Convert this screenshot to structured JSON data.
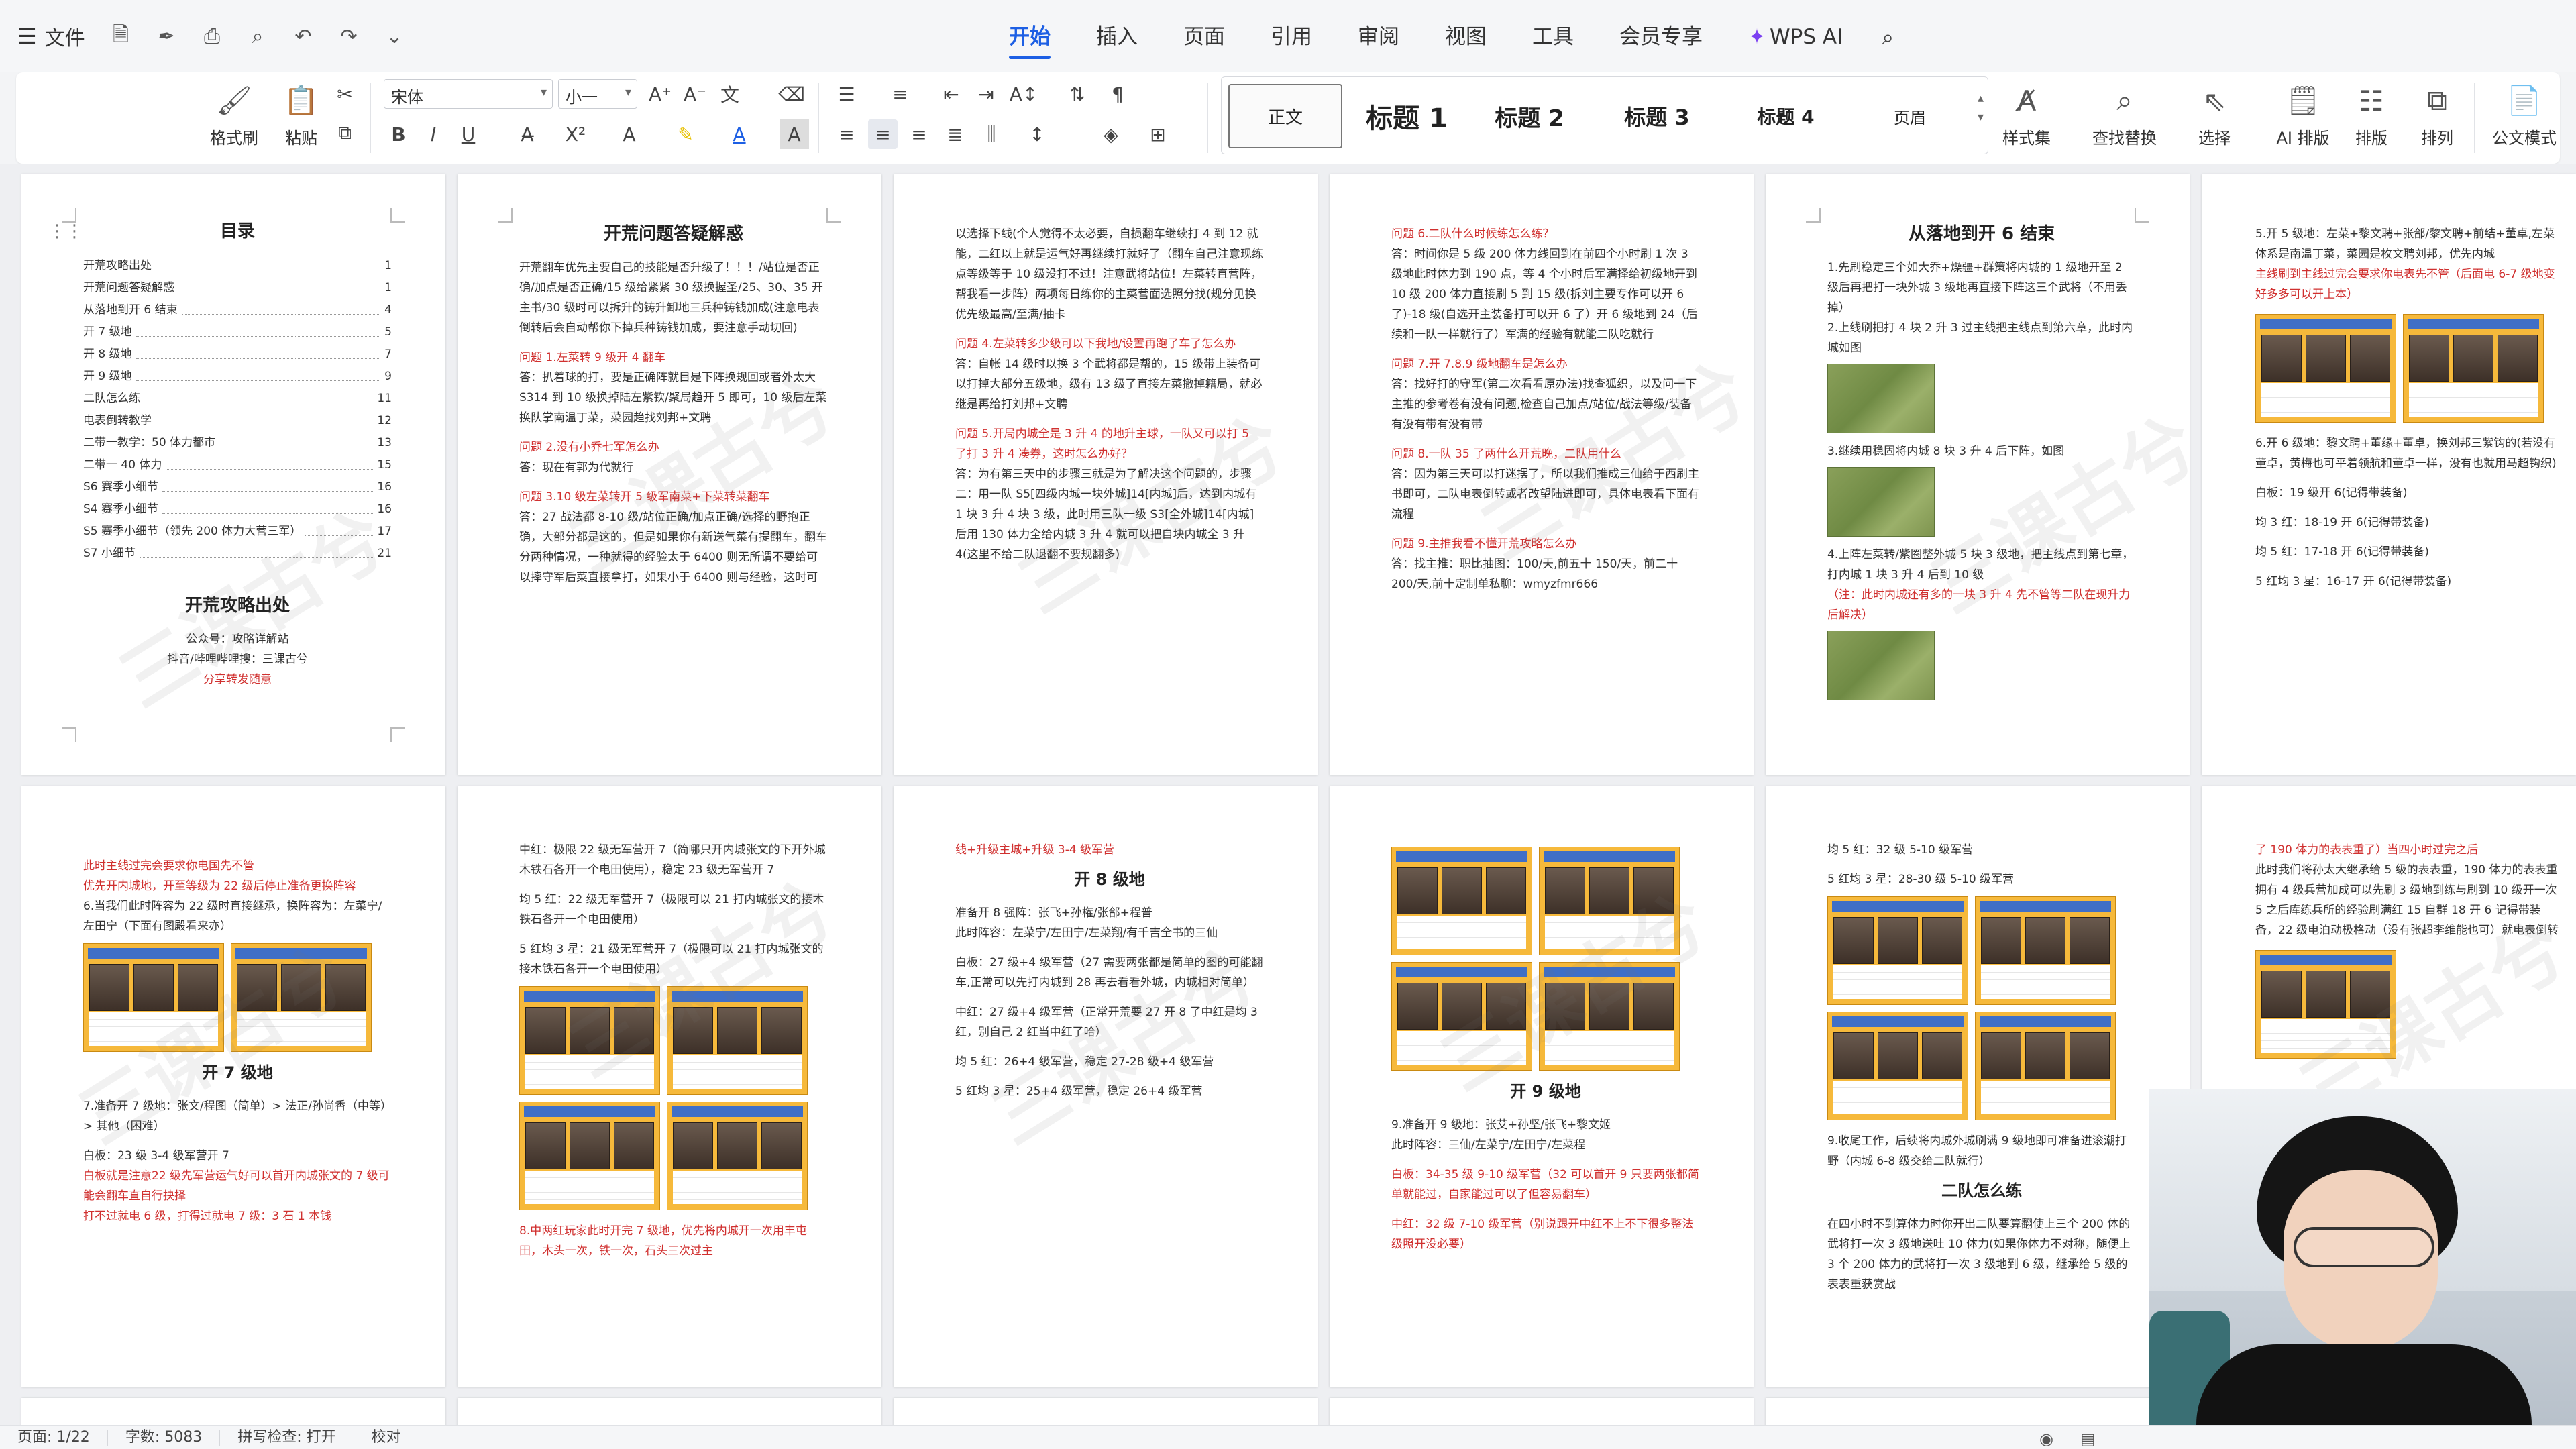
{
  "menubar": {
    "file": "文件",
    "tabs": [
      "开始",
      "插入",
      "页面",
      "引用",
      "审阅",
      "视图",
      "工具",
      "会员专享",
      "WPS AI"
    ],
    "active_tab": "开始"
  },
  "ribbon": {
    "format_painter": "格式刷",
    "paste": "粘贴",
    "font_name": "宋体",
    "font_size": "小一",
    "styles": [
      "正文",
      "标题 1",
      "标题 2",
      "标题 3",
      "标题 4",
      "页眉"
    ],
    "style_set": "样式集",
    "find_replace": "查找替换",
    "select": "选择",
    "ai_layout": "AI 排版",
    "layout": "排版",
    "arrange": "排列",
    "doc_mode": "公文模式"
  },
  "pages": {
    "p1": {
      "toc_title": "目录",
      "toc": [
        {
          "t": "开荒攻略出处",
          "n": "1"
        },
        {
          "t": "开荒问题答疑解惑",
          "n": "1"
        },
        {
          "t": "从落地到开 6 结束",
          "n": "4"
        },
        {
          "t": "开 7 级地",
          "n": "5"
        },
        {
          "t": "开 8 级地",
          "n": "7"
        },
        {
          "t": "开 9 级地",
          "n": "9"
        },
        {
          "t": "二队怎么练",
          "n": "11"
        },
        {
          "t": "电表倒转教学",
          "n": "12"
        },
        {
          "t": "二带一教学：50 体力都市",
          "n": "13"
        },
        {
          "t": "二带一 40 体力",
          "n": "15"
        },
        {
          "t": "S6 赛季小细节",
          "n": "16"
        },
        {
          "t": "S4 赛季小细节",
          "n": "16"
        },
        {
          "t": "S5 赛季小细节（领先 200 体力大营三军）",
          "n": "17"
        },
        {
          "t": "S7 小细节",
          "n": "21"
        }
      ],
      "section_title": "开荒攻略出处",
      "line1": "公众号：攻略详解站",
      "line2": "抖音/哔哩哔哩搜：三课古兮",
      "line3": "分享转发随意"
    },
    "p2": {
      "title": "开荒问题答疑解惑",
      "intro": "开荒翻车优先主要自己的技能是否升级了！！！/站位是否正确/加点是否正确/15 级给紧紧 30 级换握圣/25、30、35 开主书/30 级时可以拆升的铸升卸地三兵种铸钱加成(注意电表倒转后会自动帮你下掉兵种铸钱加成，要注意手动切回)",
      "q1": "问题 1.左菜转 9 级开 4 翻车",
      "a1": "答：扒着球的打，要是正确阵就目是下阵换规回或者外太大 S314 到 10 级换掉陆左紫钦/聚局趋开 5 即可，10 级后左菜换队掌南温丁菜，菜园趋找刘邦+文聘",
      "q2": "问题 2.没有小乔七军怎么办",
      "a2": "答：現在有郭为代就行",
      "q3": "问题 3.10 级左菜转开 5 级军南菜+下菜转菜翻车",
      "a3": "答：27 战法都 8-10 级/站位正确/加点正确/选择的野抱正确，大部分都是这的，但是如果你有新送气菜有提翻车，翻车分两种情况，一种就得的经验太于 6400 则无所谓不要给可以摔守军后菜直接拿打，如果小于 6400 则与经验，这时可"
    },
    "p3": {
      "body1": "以选择下线(个人觉得不太必要，自损翻车继续打 4 到 12 就能，二红以上就是运气好再继续打就好了（翻车自己注意现练点等级等于 10 级没打不过！注意武将站位！左菜转直营阵，帮我看一步阵）两项每日练你的主菜营面选照分找(规分见换优先级最高/至满/抽卡",
      "q4": "问题 4.左菜转多少级可以下我地/设置再跑了车了怎么办",
      "a4": "答：自帐 14 级时以换 3 个武将都是帮的，15 级带上装备可以打掉大部分五级地，级有 13 级了直接左菜撤掉籍局，就必继是再给打刘邦+文聘",
      "q5": "问题 5.开局内城全是 3 升 4 的地升主球，一队又可以打 5 了打 3 升 4 凑券，这时怎么办好？",
      "a5": "答：为有第三天中的步骤三就是为了解决这个问题的，步骤二：用一队 S5[四级内城一块外城]14[内城]后，达到内城有 1 块 3 升 4 块 3 级，此时用三队一级 S3[全外城]14[内城]后用 130 体力全给内城 3 升 4 就可以把自块内城全 3 升 4(这里不给二队退翻不要规翻多)"
    },
    "p4": {
      "q6": "问题 6.二队什么时候练怎么练？",
      "a6": "答：时间你是 5 级 200 体力线回到在前四个小时刷 1 次 3 级地此时体力到 190 点，等 4 个小时后军满择给初级地开到 10 级 200 体力直接刷 5 到 15 级(拆刘主要专作可以开 6 了)-18 级(自选开主装备打可以开 6 了）开 6 级地到 24（后续和一队一样就行了）军满的经验有就能二队吃就行",
      "q7": "问题 7.开 7.8.9 级地翻车是怎么办",
      "a7": "答：找好打的守军(第二次看看原办法)找查狐织，以及问一下主推的参考卷有没有问题,检查自己加点/站位/战法等级/装备有没有带有没有带",
      "q8": "问题 8.一队 35 了两什么开荒晚，二队用什么",
      "a8": "答：因为第三天可以打迷摆了，所以我们推成三仙给于西刷主书即可，二队电表倒转或者改望陆进即可，具体电表看下面有流程",
      "q9": "问题 9.主推我看不懂开荒攻略怎么办",
      "a9": "答：找主推：职比抽图：100/天,前五十 150/天，前二十 200/天,前十定制单私聊：wmyzfmr666"
    },
    "p5": {
      "title": "从落地到开 6 结束",
      "s1": "1.先刷稳定三个如大乔+燥疆+群策将内城的 1 级地开至 2 级后再把打一块外城 3 级地再直接下阵这三个武将（不用丢掉）",
      "s2": "2.上线刷把打 4 块 2 升 3 过主线把主线点到第六章，此时内城如图",
      "s3": "3.继续用稳固将内城 8 块 3 升 4 后下阵，如图",
      "s4": "4.上阵左菜转/紫圈整外城 5 块 3 级地，把主线点到第七章，打内城 1 块 3 升 4 后到 10 级",
      "s4note": "（注：此时内城还有多的一块 3 升 4 先不管等二队在现升力后解决）"
    },
    "p6": {
      "s5": "5.开 5 级地：左菜+黎文聘+张郃/黎文聘+前结+董卓,左菜体系是南温丁菜，菜园是枚文聘刘邦，优先内城",
      "s5red": "主线刷到主线过完会要求你电表先不管（后面电 6-7 级地变好多多可以开上本）",
      "s6": "6.开 6 级地：黎文聘+董缘+董卓，换刘邦三紫钩的(若没有董卓，黄梅也可平着领航和董卓一样，没有也就用马超钩织)",
      "r1": "白板：19 级开 6(记得带装备)",
      "r2": "均 3 红：18-19 开 6(记得带装备)",
      "r3": "均 5 红：17-18 开 6(记得带装备)",
      "r4": "5 红均 3 星：16-17 开 6(记得带装备)"
    },
    "p7": {
      "l1": "此时主线过完会要求你电国先不管",
      "l2": "优先开内城地，开至等级为 22 级后停止准备更换阵容",
      "l3": "6.当我们此时阵容为 22 级时直接继承，换阵容为：左菜宁/左田宁（下面有图殿看来亦）",
      "title": "开 7 级地",
      "l4": "7.准备开 7 级地：张文/程图（简单）> 法正/孙尚香（中等）> 其他（困难）",
      "l5": "白板：23 级 3-4 级军营开 7",
      "l6": "白板就是注意22 级先军营运气好可以首开内城张文的 7 级可能会翻车直自行抉择",
      "l7": "打不过就电 6 级，打得过就电 7 级：3 石 1 本钱"
    },
    "p8": {
      "l1": "中红：极限 22 级无军营开 7（简哪只开内城张文的下开外城木铁石各开一个电田使用），稳定 23 级无军营开 7",
      "l2": "均 5 红：22 级无军营开 7（极限可以 21 打内城张文的接木铁石各开一个电田使用）",
      "l3": "5 红均 3 星：21 级无军营开 7（极限可以 21 打内城张文的接木铁石各开一个电田使用）",
      "l4": "8.中两红玩家此时开完 7 级地，优先将内城开一次用丰屯田，木头一次，铁一次，石头三次过主"
    },
    "p9": {
      "l0": "线+升级主城+升级 3-4 级军营",
      "title": "开 8 级地",
      "l1": "准备开 8 强阵：张飞+孙権/张郃+程普",
      "l2": "此时阵容：左菜宁/左田宁/左菜翔/有千吉全书的三仙",
      "l3": "白板：27 级+4 级军营（27 需要两张都是简单的图的可能翻车,正常可以先打内城到 28 再去看看外城，内城相对简单）",
      "l4": "中红：27 级+4 级军营（正常开荒要 27 开 8 了中红是均 3 红，别自己 2 红当中红了哈）",
      "l5": "均 5 红：26+4 级军营，稳定 27-28 级+4 级军营",
      "l6": "5 红均 3 星：25+4 级军营，稳定 26+4 级军营"
    },
    "p10": {
      "title": "开 9 级地",
      "l1": "9.准备开 9 级地：张艾+孙坚/张飞+黎文姬",
      "l2": "此时阵容：三仙/左菜宁/左田宁/左菜程",
      "l3": "白板：34-35 级 9-10 级军营（32 可以首开 9 只要两张都简单就能过，自家能过可以了但容易翻车）",
      "l4": "中红：32 级 7-10 级军营（别说跟开中红不上不下很多整法级照开没必要）"
    },
    "p11": {
      "l1": "均 5 红：32 级 5-10 级军营",
      "l2": "5 红均 3 星：28-30 级 5-10 级军营",
      "l3": "9.收尾工作，后续将内城外城刷满 9 级地即可准备进滚潮打野（内城 6-8 级交给二队就行）",
      "title": "二队怎么练",
      "l4": "在四小时不到算体力时你开出二队要算翻使上三个 200 体的武将打一次 3 级地送吐 10 体力(如果你体力不对称，随便上 3 个 200 体力的武将打一次 3 级地到 6 级，继承给 5 级的表表重获赏战"
    },
    "p12": {
      "l1": "了 190 体力的表表重了）当四小时过完之后",
      "l2": "此时我们将孙太大继承给 5 级的表表重，190 体力的表表重拥有 4 级兵营加成可以先刷 3 级地到练与刷到 10 级开一次 5 之后库练兵所的经验刷满红 15 自群 18 开 6 记得带装备，22 级电泊动极格动（没有张超李维能也可）就电表倒转"
    }
  },
  "watermark": "三课古兮",
  "status": {
    "page": "页面: 1/22",
    "words": "字数: 5083",
    "spell": "拼写检查: 打开",
    "proof": "校对"
  },
  "colors": {
    "accent": "#1d5fe4",
    "red_text": "#d0302f"
  }
}
